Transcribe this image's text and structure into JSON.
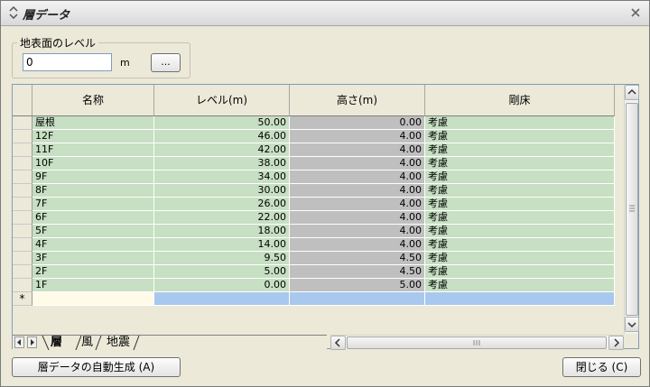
{
  "window": {
    "title": "層データ"
  },
  "level_group": {
    "label": "地表面のレベル",
    "value": "0",
    "unit": "m",
    "browse_label": "..."
  },
  "grid": {
    "columns": [
      "名称",
      "レベル(m)",
      "高さ(m)",
      "剛床"
    ],
    "rows": [
      {
        "name": "屋根",
        "level": "50.00",
        "height": "0.00",
        "floor": "考慮"
      },
      {
        "name": "12F",
        "level": "46.00",
        "height": "4.00",
        "floor": "考慮"
      },
      {
        "name": "11F",
        "level": "42.00",
        "height": "4.00",
        "floor": "考慮"
      },
      {
        "name": "10F",
        "level": "38.00",
        "height": "4.00",
        "floor": "考慮"
      },
      {
        "name": "9F",
        "level": "34.00",
        "height": "4.00",
        "floor": "考慮"
      },
      {
        "name": "8F",
        "level": "30.00",
        "height": "4.00",
        "floor": "考慮"
      },
      {
        "name": "7F",
        "level": "26.00",
        "height": "4.00",
        "floor": "考慮"
      },
      {
        "name": "6F",
        "level": "22.00",
        "height": "4.00",
        "floor": "考慮"
      },
      {
        "name": "5F",
        "level": "18.00",
        "height": "4.00",
        "floor": "考慮"
      },
      {
        "name": "4F",
        "level": "14.00",
        "height": "4.00",
        "floor": "考慮"
      },
      {
        "name": "3F",
        "level": "9.50",
        "height": "4.50",
        "floor": "考慮"
      },
      {
        "name": "2F",
        "level": "5.00",
        "height": "4.50",
        "floor": "考慮"
      },
      {
        "name": "1F",
        "level": "0.00",
        "height": "5.00",
        "floor": "考慮"
      }
    ],
    "new_row_marker": "*"
  },
  "tabs": [
    "層",
    "風",
    "地震"
  ],
  "buttons": {
    "auto_generate": "層データの自動生成 (A)",
    "close": "閉じる (C)"
  },
  "colors": {
    "green_cell": "#c7dfc3",
    "gray_cell": "#bfbfbf",
    "new_row_blue": "#a8c8ee",
    "new_row_name": "#fffbe8"
  }
}
